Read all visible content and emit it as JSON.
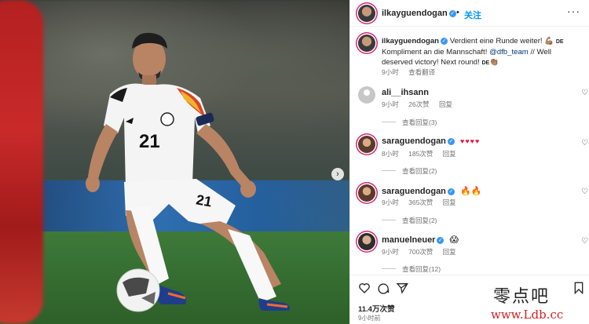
{
  "header": {
    "username": "ilkayguendogan",
    "separator": "•",
    "follow_label": "关注",
    "more_label": "···"
  },
  "caption": {
    "username": "ilkayguendogan",
    "text_1": "Verdient eine Runde weiter! 💪🏽",
    "flag_1": "DE",
    "text_2": "Kompliment an die Mannschaft! ",
    "mention": "@dfb_team",
    "text_3": " // Well deserved victory! Next round! ",
    "flag_2": "DE",
    "emoji_end": "👏🏽",
    "time": "9小时",
    "translate_label": "查看翻译"
  },
  "comments": [
    {
      "username": "ali__ihsann",
      "verified": false,
      "text": "",
      "time": "9小时",
      "likes": "26次赞",
      "reply_label": "回复",
      "view_replies": "查看回复(3)"
    },
    {
      "username": "saraguendogan",
      "verified": true,
      "text": "♥♥♥♥",
      "time": "8小时",
      "likes": "185次赞",
      "reply_label": "回复",
      "view_replies": "查看回复(2)"
    },
    {
      "username": "saraguendogan",
      "verified": true,
      "text": "🔥🔥",
      "time": "9小时",
      "likes": "365次赞",
      "reply_label": "回复",
      "view_replies": "查看回复(2)"
    },
    {
      "username": "manuelneuer",
      "verified": true,
      "text": "😱",
      "time": "9小时",
      "likes": "700次赞",
      "reply_label": "回复",
      "view_replies": "查看回复(12)"
    }
  ],
  "actions": {
    "likes_count": "11.4万次赞",
    "time": "9小时前"
  },
  "photo": {
    "jersey_number": "21",
    "next_icon": "chevron-right-icon"
  },
  "watermark": {
    "text": "零点吧",
    "url": "www.Ldb.cc"
  },
  "colors": {
    "accent": "#0095f6",
    "verified": "#3897f0",
    "heart_red": "#e21c3d",
    "watermark_red": "#d42020"
  }
}
